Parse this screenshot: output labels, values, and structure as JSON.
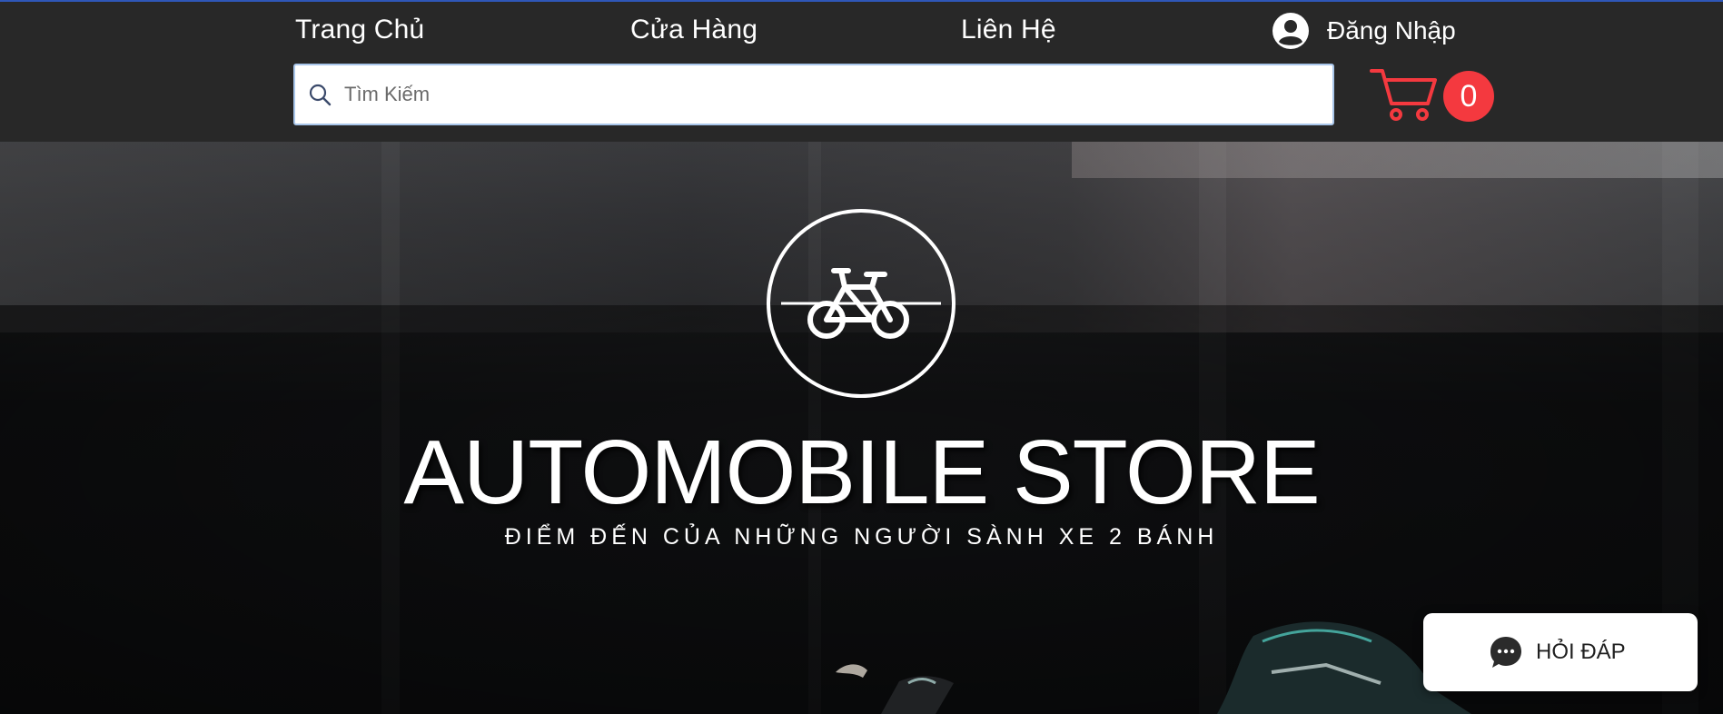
{
  "header": {
    "nav": [
      {
        "label": "Trang Chủ"
      },
      {
        "label": "Cửa Hàng"
      },
      {
        "label": "Liên Hệ"
      }
    ],
    "login_label": "Đăng Nhập",
    "search": {
      "placeholder": "Tìm Kiếm",
      "value": ""
    },
    "cart": {
      "count": "0"
    }
  },
  "hero": {
    "title": "AUTOMOBILE STORE",
    "subtitle": "ĐIỂM ĐẾN CỦA NHỮNG NGƯỜI SÀNH XE 2 BÁNH"
  },
  "chat": {
    "label": "HỎI ĐÁP"
  },
  "colors": {
    "header_bg": "#282828",
    "cart_accent": "#f4393f",
    "top_line": "#2f57b8"
  },
  "icons": [
    "user-icon",
    "search-icon",
    "cart-icon",
    "bicycle-logo-icon",
    "chat-bubble-icon"
  ]
}
